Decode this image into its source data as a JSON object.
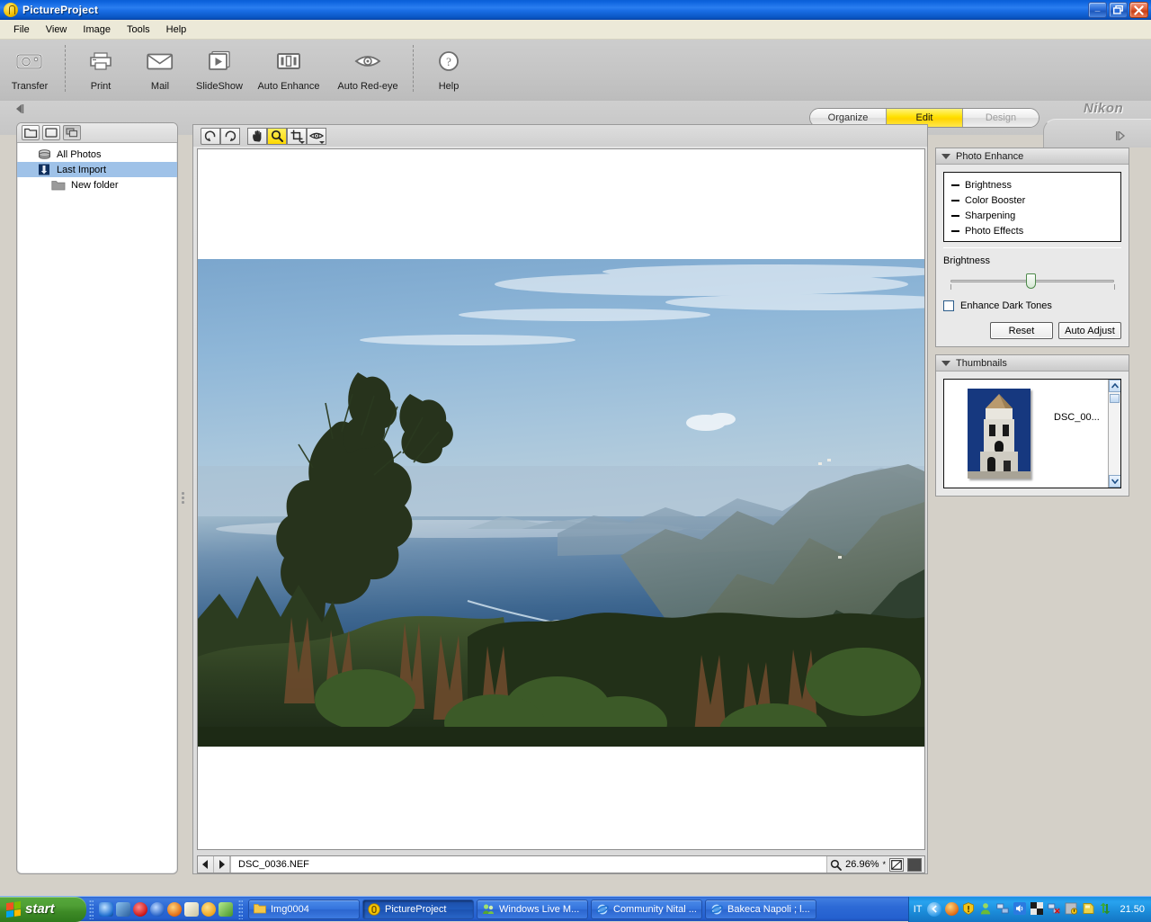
{
  "window": {
    "title": "PictureProject",
    "app_icon": "pictureproject-icon",
    "buttons": [
      {
        "name": "minimize-button",
        "glyph": "_"
      },
      {
        "name": "maximize-button",
        "glyph": "❐"
      },
      {
        "name": "close-button",
        "glyph": "✕"
      }
    ]
  },
  "menubar": {
    "items": [
      "File",
      "View",
      "Image",
      "Tools",
      "Help"
    ]
  },
  "toolbar": {
    "items": [
      {
        "label": "Transfer",
        "icon": "camera-icon"
      },
      {
        "label": "Print",
        "icon": "printer-icon"
      },
      {
        "label": "Mail",
        "icon": "envelope-icon"
      },
      {
        "label": "SlideShow",
        "icon": "slideshow-icon"
      },
      {
        "label": "Auto Enhance",
        "icon": "auto-enhance-icon"
      },
      {
        "label": "Auto Red-eye",
        "icon": "red-eye-icon"
      },
      {
        "label": "Help",
        "icon": "help-icon"
      }
    ]
  },
  "modebar": {
    "tabs": [
      {
        "label": "Organize",
        "state": "normal"
      },
      {
        "label": "Edit",
        "state": "active"
      },
      {
        "label": "Design",
        "state": "disabled"
      }
    ],
    "brand": "Nikon",
    "collapse_left_icon": "collapse-left-arrow-icon",
    "collapse_right_icon": "expand-right-arrow-icon"
  },
  "sidebar": {
    "view_buttons": [
      {
        "name": "folder-view-button",
        "icon": "folder-icon"
      },
      {
        "name": "single-pane-button",
        "icon": "rectangle-icon"
      },
      {
        "name": "split-pane-button",
        "icon": "stacked-squares-icon"
      }
    ],
    "tree": [
      {
        "label": "All Photos",
        "icon": "database-icon",
        "selected": false,
        "indent": false
      },
      {
        "label": "Last Import",
        "icon": "import-icon",
        "selected": true,
        "indent": false
      },
      {
        "label": "New folder",
        "icon": "folder-gray-icon",
        "selected": false,
        "indent": true
      }
    ]
  },
  "image_pane": {
    "tools": [
      {
        "name": "rotate-left-tool",
        "icon": "rotate-ccw-icon",
        "active": false,
        "caret": false
      },
      {
        "name": "rotate-right-tool",
        "icon": "rotate-cw-icon",
        "active": false,
        "caret": false
      },
      {
        "name": "hand-tool",
        "icon": "hand-icon",
        "active": false,
        "caret": false
      },
      {
        "name": "zoom-tool",
        "icon": "magnifier-icon",
        "active": true,
        "caret": false
      },
      {
        "name": "crop-tool",
        "icon": "crop-icon",
        "active": false,
        "caret": true
      },
      {
        "name": "red-eye-tool",
        "icon": "eye-icon",
        "active": false,
        "caret": true
      }
    ],
    "status": {
      "prev_icon": "previous-arrow-icon",
      "next_icon": "next-arrow-icon",
      "filename": "DSC_0036.NEF",
      "zoom_icon": "magnifier-icon",
      "zoom_value": "26.96%",
      "fit_button_icon": "fit-to-window-icon",
      "actual_button_icon": "actual-size-icon"
    }
  },
  "photo_enhance": {
    "title": "Photo Enhance",
    "list": [
      "Brightness",
      "Color Booster",
      "Sharpening",
      "Photo Effects"
    ],
    "slider_label": "Brightness",
    "slider_position_percent": 50,
    "checkbox": {
      "label": "Enhance Dark Tones",
      "checked": false
    },
    "buttons": [
      {
        "label": "Reset",
        "name": "reset-button"
      },
      {
        "label": "Auto Adjust",
        "name": "auto-adjust-button"
      }
    ]
  },
  "thumbnails": {
    "title": "Thumbnails",
    "items": [
      {
        "label": "DSC_00...",
        "image": "bell-tower-thumbnail"
      }
    ],
    "scroll_up_icon": "chevron-up-icon",
    "scroll_down_icon": "chevron-down-icon"
  },
  "taskbar": {
    "start_label": "start",
    "quick_launch": [
      {
        "name": "internet-explorer-quicklaunch",
        "color": "#2e7ddb"
      },
      {
        "name": "outlook-quicklaunch",
        "color": "#3b6fb5"
      },
      {
        "name": "opera-quicklaunch",
        "color": "#d22a2a"
      },
      {
        "name": "media-player-quicklaunch",
        "color": "#2a6fd2"
      },
      {
        "name": "firefox-quicklaunch",
        "color": "#e07a1a"
      },
      {
        "name": "notepad-quicklaunch",
        "color": "#e8e3c8"
      },
      {
        "name": "chrome-quicklaunch",
        "color": "#f0a820"
      },
      {
        "name": "messenger-quicklaunch",
        "color": "#6cbf3a"
      }
    ],
    "tasks": [
      {
        "label": "Img0004",
        "icon": "folder-icon",
        "active": false
      },
      {
        "label": "PictureProject",
        "icon": "pictureproject-icon",
        "active": true
      },
      {
        "label": "Windows Live M...",
        "icon": "messenger-icon",
        "active": false
      },
      {
        "label": "Community Nital ...",
        "icon": "internet-explorer-icon",
        "active": false
      },
      {
        "label": "Bakeca Napoli ; l...",
        "icon": "internet-explorer-icon",
        "active": false
      }
    ],
    "tray": {
      "language": "IT",
      "chevron_icon": "show-hidden-icons-chevron",
      "icons": [
        {
          "name": "firefox-tray-icon",
          "color": "#e07a1a"
        },
        {
          "name": "warning-shield-tray-icon",
          "color": "#f0c020"
        },
        {
          "name": "user-tray-icon",
          "color": "#8fd44a"
        },
        {
          "name": "network-tray-icon",
          "color": "#4a7fd4"
        },
        {
          "name": "volume-tray-icon",
          "color": "#2a7ae0"
        },
        {
          "name": "checkers-tray-icon",
          "color": "#2b2b2b"
        },
        {
          "name": "network-disconnected-tray-icon",
          "color": "#4a7fd4"
        },
        {
          "name": "security-alert-tray-icon",
          "color": "#9aa0a8"
        },
        {
          "name": "gold-disk-tray-icon",
          "color": "#ecd24a"
        },
        {
          "name": "update-arrows-tray-icon",
          "color": "#3aa83a"
        }
      ],
      "clock": "21.50"
    }
  }
}
